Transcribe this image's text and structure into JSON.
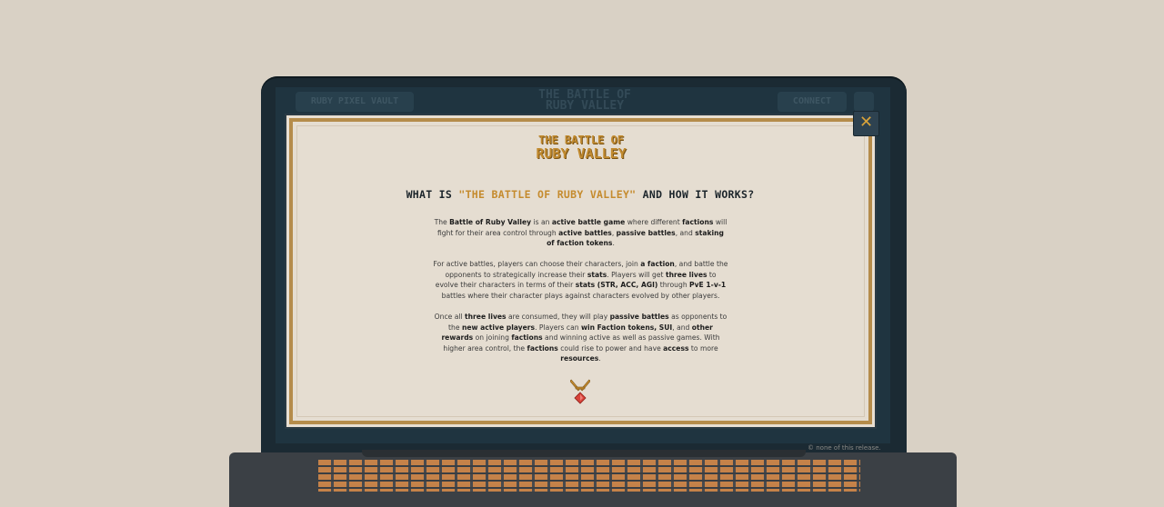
{
  "background_app": {
    "left_pill_label": "RUBY PIXEL VAULT",
    "logo_text": "THE BATTLE OF RUBY VALLEY",
    "connect_label": "CONNECT"
  },
  "footer_legal": "© none of this release.",
  "modal": {
    "close_symbol": "✕",
    "logo": {
      "line1": "THE BATTLE OF",
      "line2": "RUBY VALLEY"
    },
    "heading": {
      "prefix": "WHAT IS ",
      "highlight": "\"THE BATTLE OF RUBY VALLEY\"",
      "suffix": " AND HOW IT WORKS?"
    },
    "paragraphs": [
      [
        {
          "t": "The ",
          "b": false
        },
        {
          "t": "Battle of Ruby Valley",
          "b": true
        },
        {
          "t": " is an ",
          "b": false
        },
        {
          "t": "active battle game",
          "b": true
        },
        {
          "t": " where different ",
          "b": false
        },
        {
          "t": "factions",
          "b": true
        },
        {
          "t": " will fight for their area control through ",
          "b": false
        },
        {
          "t": "active battles",
          "b": true
        },
        {
          "t": ", ",
          "b": false
        },
        {
          "t": "passive battles",
          "b": true
        },
        {
          "t": ", and ",
          "b": false
        },
        {
          "t": "staking of faction tokens",
          "b": true
        },
        {
          "t": ".",
          "b": false
        }
      ],
      [
        {
          "t": "For active battles, players can choose their characters, join ",
          "b": false
        },
        {
          "t": "a faction",
          "b": true
        },
        {
          "t": ", and battle the opponents to strategically increase their ",
          "b": false
        },
        {
          "t": "stats",
          "b": true
        },
        {
          "t": ". Players will get ",
          "b": false
        },
        {
          "t": "three lives",
          "b": true
        },
        {
          "t": " to evolve their characters in terms of their ",
          "b": false
        },
        {
          "t": "stats (STR, ACC, AGI)",
          "b": true
        },
        {
          "t": " through ",
          "b": false
        },
        {
          "t": "PvE 1-v-1",
          "b": true
        },
        {
          "t": " battles where their character plays against characters evolved by other players.",
          "b": false
        }
      ],
      [
        {
          "t": "Once all ",
          "b": false
        },
        {
          "t": "three lives",
          "b": true
        },
        {
          "t": " are consumed, they will play ",
          "b": false
        },
        {
          "t": "passive battles",
          "b": true
        },
        {
          "t": " as opponents to the ",
          "b": false
        },
        {
          "t": "new active players",
          "b": true
        },
        {
          "t": ". Players can ",
          "b": false
        },
        {
          "t": "win Faction tokens, SUI",
          "b": true
        },
        {
          "t": ", and ",
          "b": false
        },
        {
          "t": "other rewards",
          "b": true
        },
        {
          "t": " on joining ",
          "b": false
        },
        {
          "t": "factions",
          "b": true
        },
        {
          "t": " and winning active as well as passive games. With higher area control, the ",
          "b": false
        },
        {
          "t": "factions",
          "b": true
        },
        {
          "t": " could rise to power and have ",
          "b": false
        },
        {
          "t": "access",
          "b": true
        },
        {
          "t": " to more ",
          "b": false
        },
        {
          "t": "resources",
          "b": true
        },
        {
          "t": ".",
          "b": false
        }
      ]
    ],
    "emblem_icon": "crossed-swords-ruby-icon"
  },
  "colors": {
    "accent_gold": "#c58b2e",
    "modal_bg": "#e5ddd1",
    "screen_bg": "#1f3440",
    "page_bg": "#d9d1c5"
  }
}
